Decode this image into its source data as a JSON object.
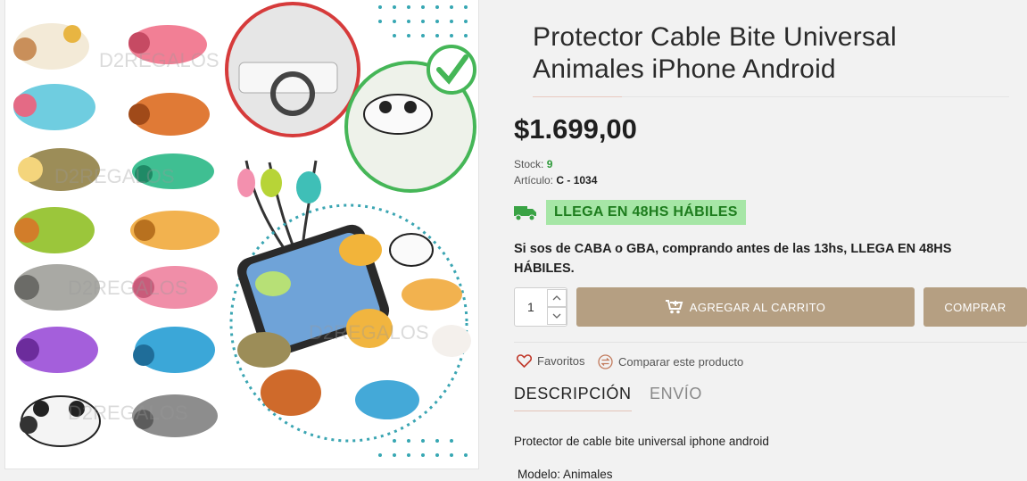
{
  "product": {
    "title": "Protector Cable Bite Universal Animales iPhone Android",
    "price": "$1.699,00",
    "stock_label": "Stock:",
    "stock_value": "9",
    "sku_label": "Artículo:",
    "sku_value": "C - 1034",
    "shipping_badge": "LLEGA EN 48HS HÁBILES",
    "shipping_notice": "Si sos de CABA o GBA, comprando antes de las 13hs, LLEGA EN 48HS HÁBILES.",
    "quantity": "1"
  },
  "actions": {
    "add_to_cart": "AGREGAR AL CARRITO",
    "buy": "COMPRAR",
    "favorites": "Favoritos",
    "compare": "Comparar este producto"
  },
  "tabs": [
    {
      "label": "DESCRIPCIÓN",
      "active": true
    },
    {
      "label": "ENVÍO",
      "active": false
    }
  ],
  "description": {
    "text": "Protector de cable bite universal iphone android",
    "model_line": "Modelo: Animales"
  },
  "image": {
    "watermark": "D2REGALOS"
  },
  "colors": {
    "button": "#b59f82",
    "badge_bg": "#a6e6a6",
    "badge_text": "#1e7d1e",
    "stock_green": "#2e9a3a",
    "truck": "#3aa345",
    "heart": "#c0392b"
  }
}
